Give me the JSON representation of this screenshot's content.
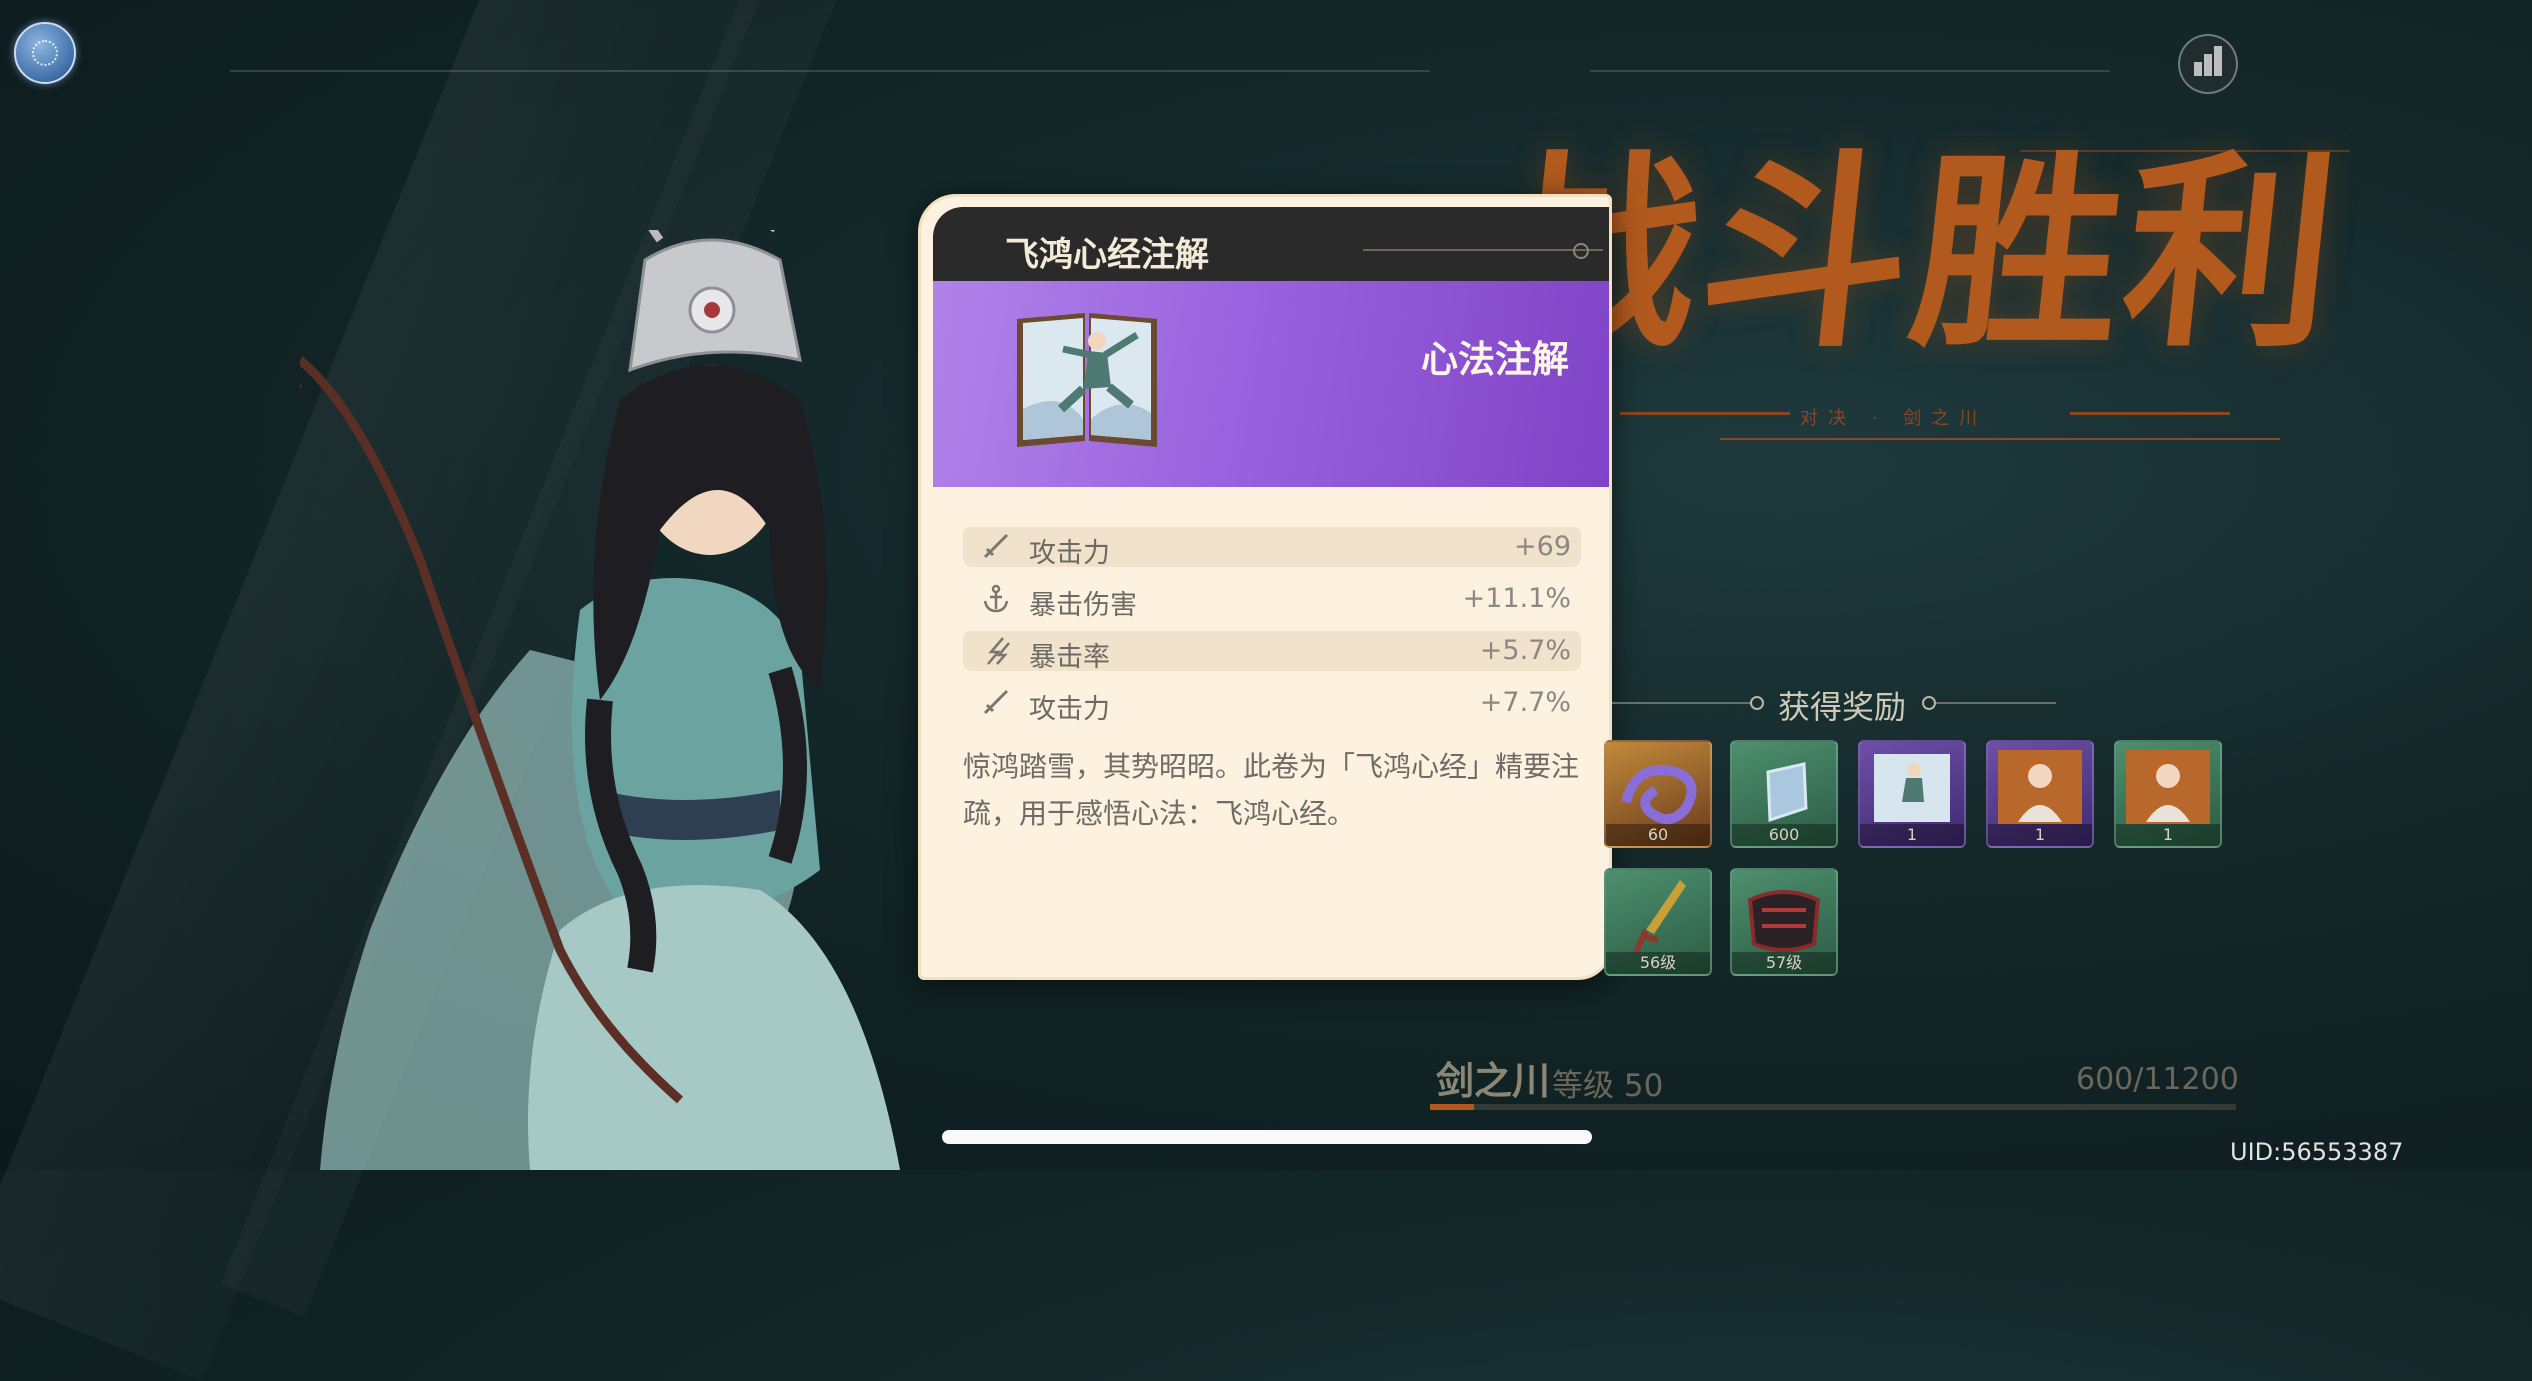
{
  "victory": {
    "title": "战斗胜利",
    "subtitle": "对决 · 剑之川"
  },
  "popup": {
    "title": "飞鸿心经注解",
    "type_label": "心法注解",
    "stats": [
      {
        "icon": "sword-icon",
        "name": "攻击力",
        "value": "+69"
      },
      {
        "icon": "anchor-icon",
        "name": "暴击伤害",
        "value": "+11.1%"
      },
      {
        "icon": "lightning-icon",
        "name": "暴击率",
        "value": "+5.7%"
      },
      {
        "icon": "sword-icon",
        "name": "攻击力",
        "value": "+7.7%"
      }
    ],
    "description": "惊鸿踏雪，其势昭昭。此卷为「飞鸿心经」精要注疏，用于感悟心法：飞鸿心经。"
  },
  "rewards": {
    "title": "获得奖励",
    "items": [
      {
        "name": "swirl-token",
        "count": "60"
      },
      {
        "name": "jade-stone",
        "count": "600"
      },
      {
        "name": "martial-book",
        "count": "1"
      },
      {
        "name": "warrior-portrait-a",
        "count": "1"
      },
      {
        "name": "warrior-portrait-b",
        "count": "1"
      },
      {
        "name": "dagger",
        "count": "56级"
      },
      {
        "name": "armor-chest",
        "count": "57级"
      }
    ]
  },
  "player": {
    "name": "剑之川",
    "level": "等级 50",
    "exp": "600/11200",
    "exp_fraction": 0.054
  },
  "uid": "UID:56553387",
  "colors": {
    "accent": "#b25a1e",
    "banner": "#9a62de",
    "panel": "#fdf1e0"
  }
}
